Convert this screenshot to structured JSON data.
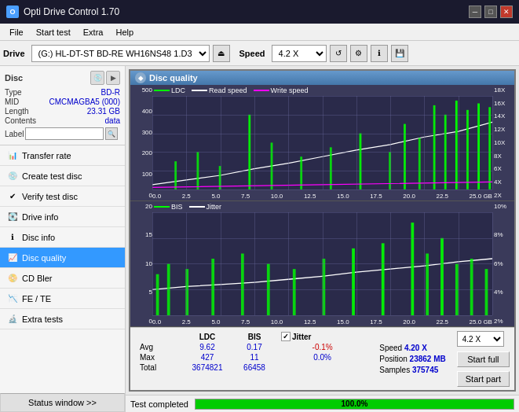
{
  "app": {
    "title": "Opti Drive Control 1.70",
    "icon": "O"
  },
  "titlebar": {
    "minimize": "─",
    "maximize": "□",
    "close": "✕"
  },
  "menu": {
    "items": [
      "File",
      "Start test",
      "Extra",
      "Help"
    ]
  },
  "drive_toolbar": {
    "drive_label": "Drive",
    "drive_value": "(G:)  HL-DT-ST BD-RE  WH16NS48 1.D3",
    "speed_label": "Speed",
    "speed_value": "4.2 X"
  },
  "disc": {
    "title": "Disc",
    "type_label": "Type",
    "type_value": "BD-R",
    "mid_label": "MID",
    "mid_value": "CMCMAGBA5 (000)",
    "length_label": "Length",
    "length_value": "23.31 GB",
    "contents_label": "Contents",
    "contents_value": "data",
    "label_label": "Label",
    "label_value": ""
  },
  "nav": {
    "items": [
      {
        "id": "transfer-rate",
        "label": "Transfer rate",
        "active": false
      },
      {
        "id": "create-test-disc",
        "label": "Create test disc",
        "active": false
      },
      {
        "id": "verify-test-disc",
        "label": "Verify test disc",
        "active": false
      },
      {
        "id": "drive-info",
        "label": "Drive info",
        "active": false
      },
      {
        "id": "disc-info",
        "label": "Disc info",
        "active": false
      },
      {
        "id": "disc-quality",
        "label": "Disc quality",
        "active": true
      },
      {
        "id": "cd-bler",
        "label": "CD Bler",
        "active": false
      },
      {
        "id": "fe-te",
        "label": "FE / TE",
        "active": false
      },
      {
        "id": "extra-tests",
        "label": "Extra tests",
        "active": false
      }
    ],
    "status_window": "Status window >>"
  },
  "panel": {
    "title": "Disc quality"
  },
  "chart_top": {
    "legend": [
      {
        "label": "LDC",
        "color": "#00ff00"
      },
      {
        "label": "Read speed",
        "color": "#ffffff"
      },
      {
        "label": "Write speed",
        "color": "#ff00ff"
      }
    ],
    "y_axis_left": [
      "500",
      "400",
      "300",
      "200",
      "100",
      "0"
    ],
    "y_axis_right": [
      "18X",
      "16X",
      "14X",
      "12X",
      "10X",
      "8X",
      "6X",
      "4X",
      "2X"
    ],
    "x_axis": [
      "0.0",
      "2.5",
      "5.0",
      "7.5",
      "10.0",
      "12.5",
      "15.0",
      "17.5",
      "20.0",
      "22.5",
      "25.0 GB"
    ]
  },
  "chart_bottom": {
    "legend": [
      {
        "label": "BIS",
        "color": "#00ff00"
      },
      {
        "label": "Jitter",
        "color": "#ffffff"
      }
    ],
    "y_axis_left": [
      "20",
      "15",
      "10",
      "5",
      "0"
    ],
    "y_axis_right": [
      "10%",
      "8%",
      "6%",
      "4%",
      "2%"
    ],
    "x_axis": [
      "0.0",
      "2.5",
      "5.0",
      "7.5",
      "10.0",
      "12.5",
      "15.0",
      "17.5",
      "20.0",
      "22.5",
      "25.0 GB"
    ]
  },
  "stats": {
    "headers": [
      "LDC",
      "BIS"
    ],
    "jitter_label": "Jitter",
    "jitter_checked": true,
    "rows": [
      {
        "label": "Avg",
        "ldc": "9.62",
        "bis": "0.17",
        "jitter": "-0.1%"
      },
      {
        "label": "Max",
        "ldc": "427",
        "bis": "11",
        "jitter": "0.0%"
      },
      {
        "label": "Total",
        "ldc": "3674821",
        "bis": "66458",
        "jitter": ""
      }
    ],
    "speed_label": "Speed",
    "speed_value": "4.20 X",
    "position_label": "Position",
    "position_value": "23862 MB",
    "samples_label": "Samples",
    "samples_value": "375745",
    "speed_select": "4.2 X",
    "btn_start_full": "Start full",
    "btn_start_part": "Start part"
  },
  "status": {
    "text": "Test completed",
    "progress": 100,
    "progress_text": "100.0%"
  }
}
